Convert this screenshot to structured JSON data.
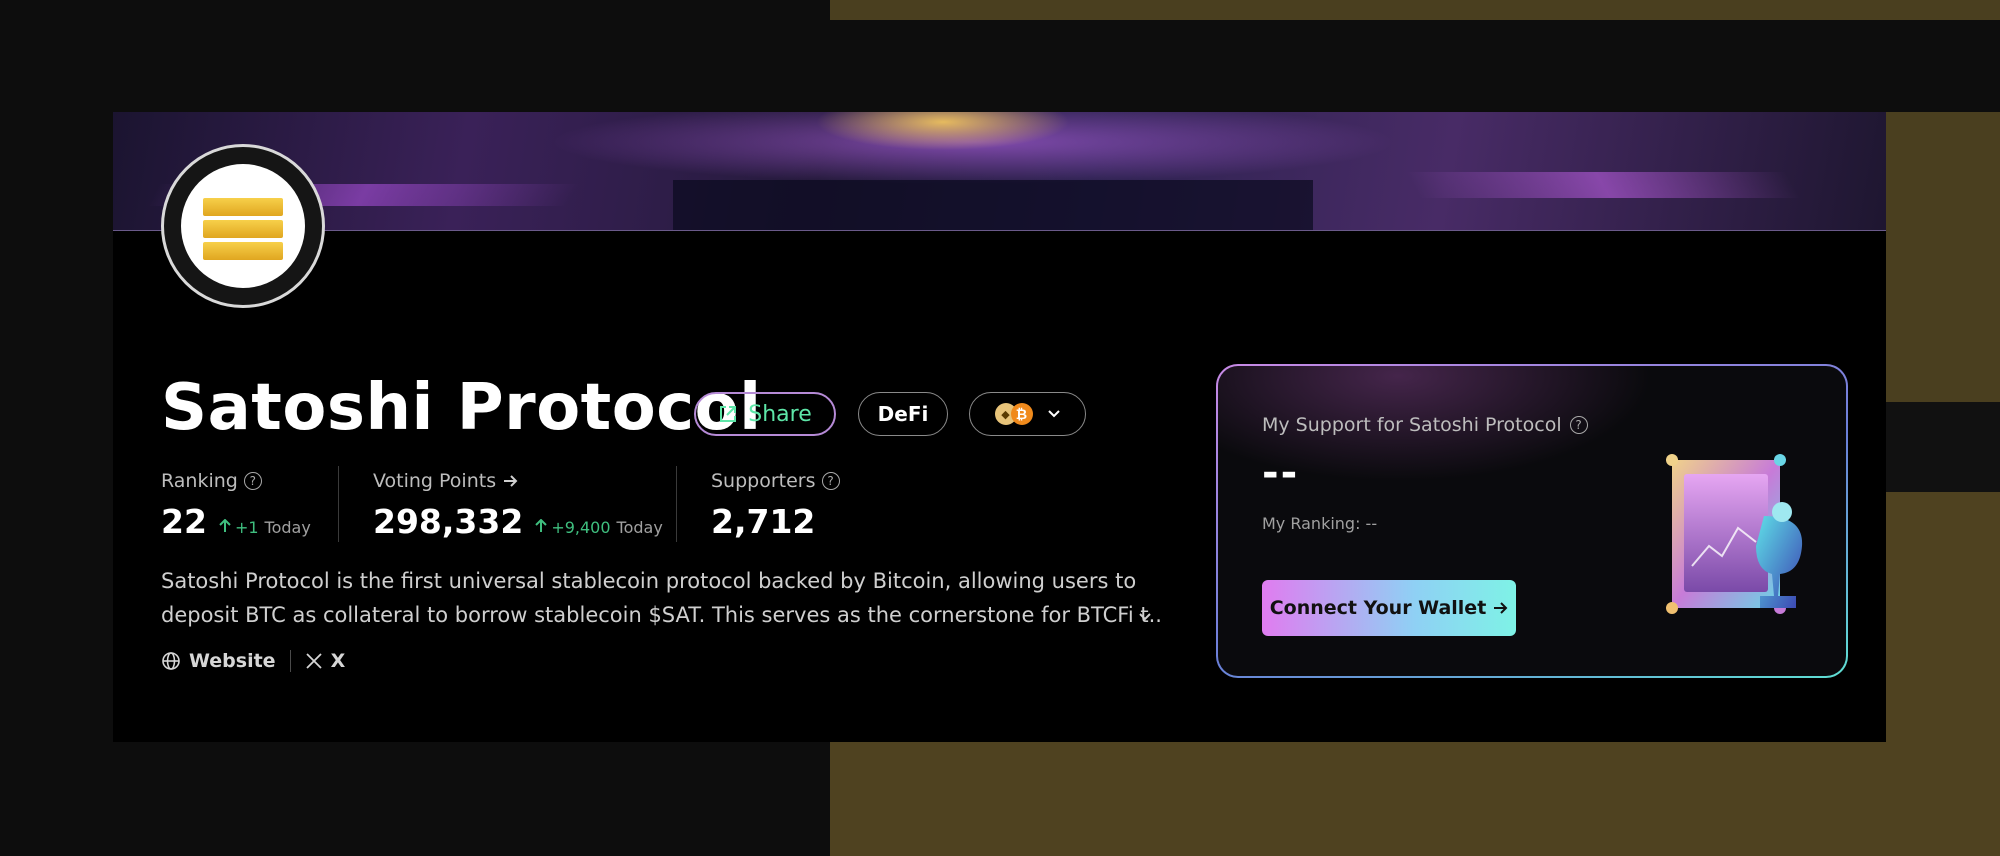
{
  "project": {
    "name": "Satoshi Protocol",
    "share_label": "Share",
    "category_label": "DeFi",
    "chain_icons": [
      "ethereum-coin-icon",
      "bitcoin-icon"
    ]
  },
  "stats": {
    "ranking": {
      "label": "Ranking",
      "value": "22",
      "delta": "+1",
      "delta_suffix": "Today"
    },
    "voting_points": {
      "label": "Voting Points",
      "value": "298,332",
      "delta": "+9,400",
      "delta_suffix": "Today"
    },
    "supporters": {
      "label": "Supporters",
      "value": "2,712"
    }
  },
  "description": {
    "line1": "Satoshi Protocol is the first universal stablecoin protocol backed by Bitcoin, allowing users to",
    "line2": "deposit BTC as collateral to borrow stablecoin $SAT. This serves as the cornerstone for BTCFi t..."
  },
  "links": {
    "website": "Website",
    "x": "X"
  },
  "support_card": {
    "title": "My Support for Satoshi Protocol",
    "value": "--",
    "my_ranking": "My Ranking: --",
    "connect_label": "Connect Your Wallet"
  },
  "colors": {
    "accent_green": "#3fbf7f",
    "share_green": "#5ee6a8",
    "gold": "#e0a620"
  }
}
